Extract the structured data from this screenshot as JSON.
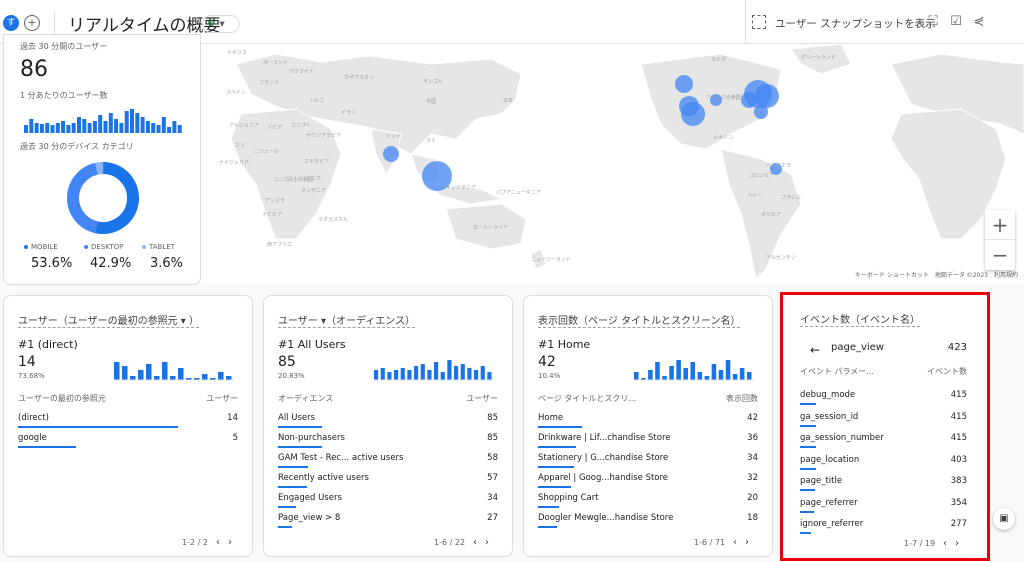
{
  "topbar": {
    "avatar_letter": "す",
    "add_label": "+",
    "title": "リアルタイムの概要",
    "status_icon": "check-circle-icon",
    "snapshot_label": "ユーザー スナップショットを表示",
    "icons": [
      "fullscreen-icon",
      "edit-chart-icon",
      "share-icon"
    ]
  },
  "summary": {
    "users_label": "過去 30 分間のユーザー",
    "users_value": "86",
    "per_min_label": "1 分あたりのユーザー数",
    "device_label": "過去 30 分のデバイス カテゴリ",
    "devices": [
      {
        "name": "MOBILE",
        "pct": "53.6%",
        "value": 53.6,
        "color": "#1a73e8"
      },
      {
        "name": "DESKTOP",
        "pct": "42.9%",
        "value": 42.9,
        "color": "#4285f4"
      },
      {
        "name": "TABLET",
        "pct": "3.6%",
        "value": 3.6,
        "color": "#8ab4f8"
      }
    ]
  },
  "map": {
    "labels": [
      "イギリス",
      "ポーランド",
      "ウクライナ",
      "スペイン",
      "フランス",
      "カザフスタン",
      "モンゴル",
      "トルコ",
      "中国",
      "日本",
      "アルジェリア",
      "リビア",
      "エジプト",
      "イラン",
      "サウジアラビア",
      "インド",
      "マリ",
      "ニジェール",
      "ナイジェリア",
      "エチオピア",
      "タイ",
      "コンゴ民主共和国",
      "ケニア",
      "タンザニア",
      "アンゴラ",
      "ナミビア",
      "マダガスカル",
      "インドネシア",
      "パプアニューギニア",
      "南アフリカ",
      "オーストラリア",
      "ニュージーランド",
      "カナダ",
      "アメリカ合衆国",
      "メキシコ",
      "ベネズエラ",
      "コロンビア",
      "ペルー",
      "ブラジル",
      "ボリビア",
      "アルゼンチン",
      "グリーンランド"
    ],
    "footer": "キーボード ショートカット　地図データ ©2023　利用規約",
    "zoom_in": "+",
    "zoom_out": "−"
  },
  "panels": [
    {
      "title": "ユーザー（ユーザーの最初の参照元 ▾ ）",
      "rank": "#1 (direct)",
      "rank_value": "14",
      "rank_pct": "73.68%",
      "col1": "ユーザーの最初の参照元",
      "col2": "ユーザー",
      "rows": [
        {
          "label": "(direct)",
          "value": "14",
          "ratio": 1.0
        },
        {
          "label": "google",
          "value": "5",
          "ratio": 0.36
        }
      ],
      "pager": "1-2 / 2"
    },
    {
      "title": "ユーザー ▾（オーディエンス）",
      "rank": "#1 All Users",
      "rank_value": "85",
      "rank_pct": "20.83%",
      "col1": "オーディエンス",
      "col2": "ユーザー",
      "rows": [
        {
          "label": "All Users",
          "value": "85",
          "ratio": 1.0
        },
        {
          "label": "Non-purchasers",
          "value": "85",
          "ratio": 1.0
        },
        {
          "label": "GAM Test - Rec... active users",
          "value": "58",
          "ratio": 0.68
        },
        {
          "label": "Recently active users",
          "value": "57",
          "ratio": 0.67
        },
        {
          "label": "Engaged Users",
          "value": "34",
          "ratio": 0.4
        },
        {
          "label": "Page_view > 8",
          "value": "27",
          "ratio": 0.32
        }
      ],
      "pager": "1-6 / 22"
    },
    {
      "title": "表示回数（ページ タイトルとスクリーン名）",
      "rank": "#1 Home",
      "rank_value": "42",
      "rank_pct": "10.4%",
      "col1": "ページ タイトルとスクリ...",
      "col2": "表示回数",
      "rows": [
        {
          "label": "Home",
          "value": "42",
          "ratio": 1.0
        },
        {
          "label": "Drinkware | Lif...chandise Store",
          "value": "36",
          "ratio": 0.86
        },
        {
          "label": "Stationery | G...chandise Store",
          "value": "34",
          "ratio": 0.81
        },
        {
          "label": "Apparel | Goog...handise Store",
          "value": "32",
          "ratio": 0.76
        },
        {
          "label": "Shopping Cart",
          "value": "20",
          "ratio": 0.48
        },
        {
          "label": "Doogler Mewgle...handise Store",
          "value": "18",
          "ratio": 0.43
        }
      ],
      "pager": "1-6 / 71"
    }
  ],
  "events_panel": {
    "title": "イベント数（イベント名）",
    "back_icon": "arrow-back-icon",
    "event_name": "page_view",
    "event_total": "423",
    "col1": "イベント パラメー...",
    "col2": "イベント数",
    "rows": [
      {
        "label": "debug_mode",
        "value": "415",
        "ratio": 1.0
      },
      {
        "label": "ga_session_id",
        "value": "415",
        "ratio": 1.0
      },
      {
        "label": "ga_session_number",
        "value": "415",
        "ratio": 1.0
      },
      {
        "label": "page_location",
        "value": "403",
        "ratio": 0.97
      },
      {
        "label": "page_title",
        "value": "383",
        "ratio": 0.92
      },
      {
        "label": "page_referrer",
        "value": "354",
        "ratio": 0.85
      },
      {
        "label": "ignore_referrer",
        "value": "277",
        "ratio": 0.67
      }
    ],
    "pager": "1-7 / 19"
  },
  "colors": {
    "accent": "#1a73e8",
    "highlight": "#e8000b",
    "bubble": "#4285f4"
  }
}
